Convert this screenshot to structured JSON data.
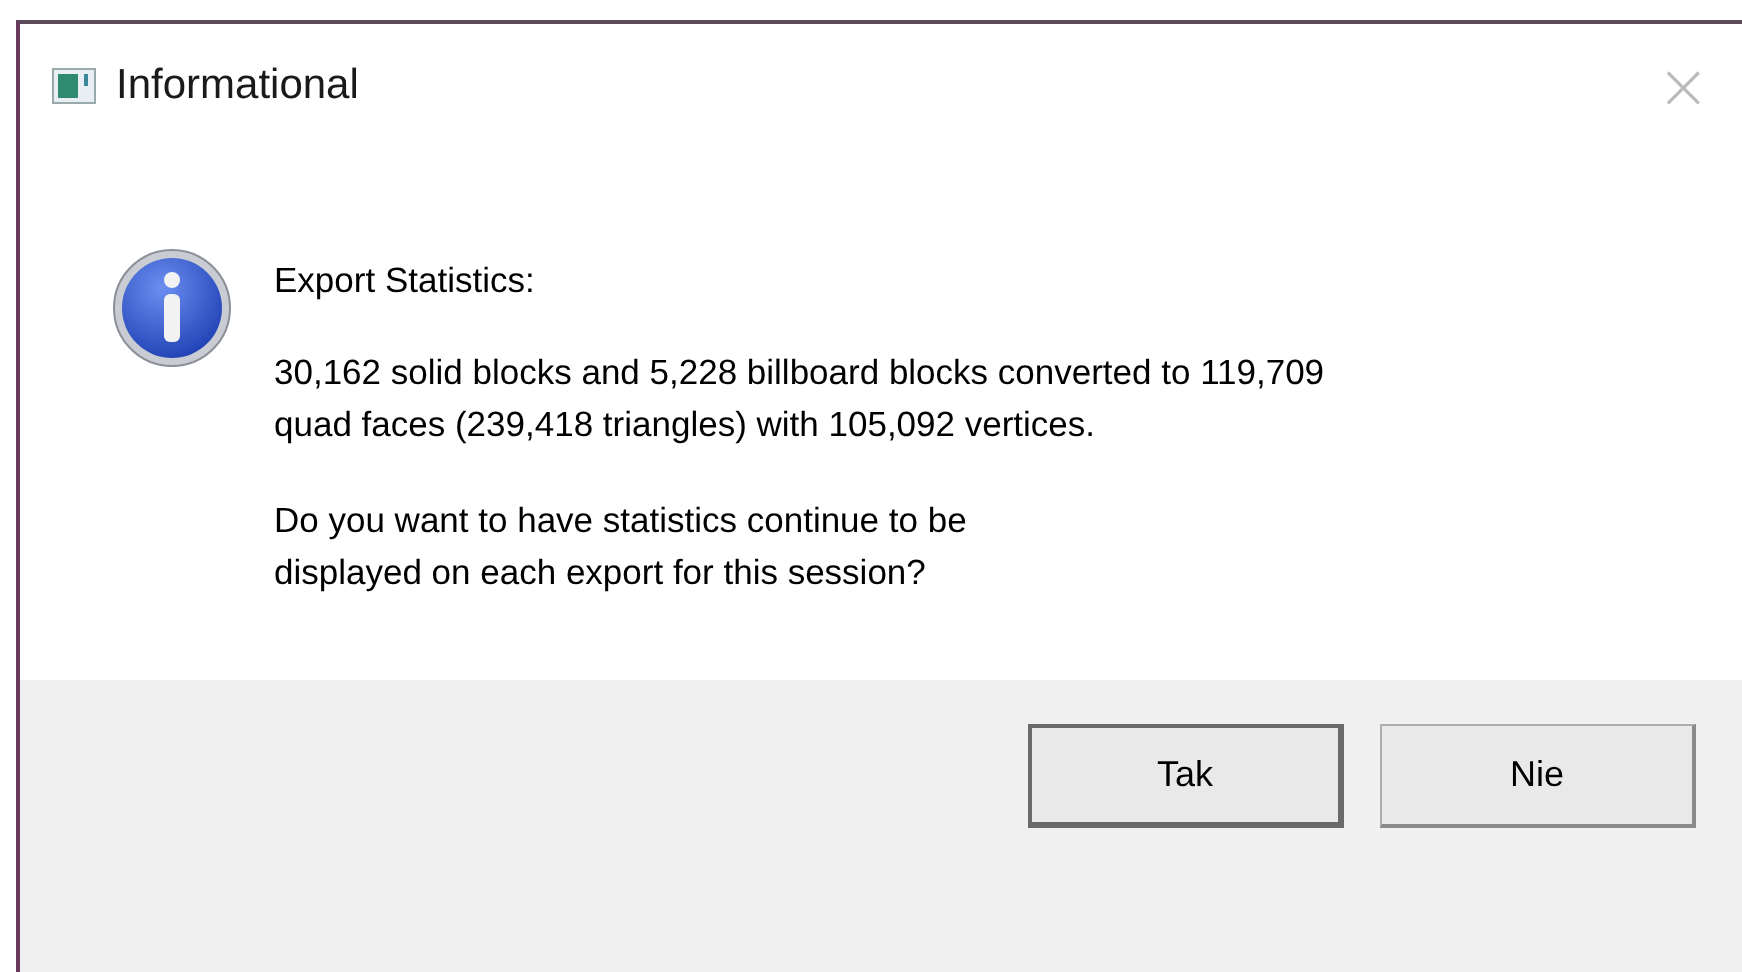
{
  "window": {
    "title": "Informational",
    "close": "×"
  },
  "message": {
    "heading": "Export Statistics:",
    "paragraphs": [
      "30,162 solid blocks and 5,228 billboard blocks converted to 119,709\nquad faces (239,418 triangles) with 105,092 vertices.",
      "Do you want to have statistics continue to be\ndisplayed on each export for this session?"
    ]
  },
  "buttons": [
    {
      "label": "Tak",
      "default": true
    },
    {
      "label": "Nie",
      "default": false
    }
  ]
}
